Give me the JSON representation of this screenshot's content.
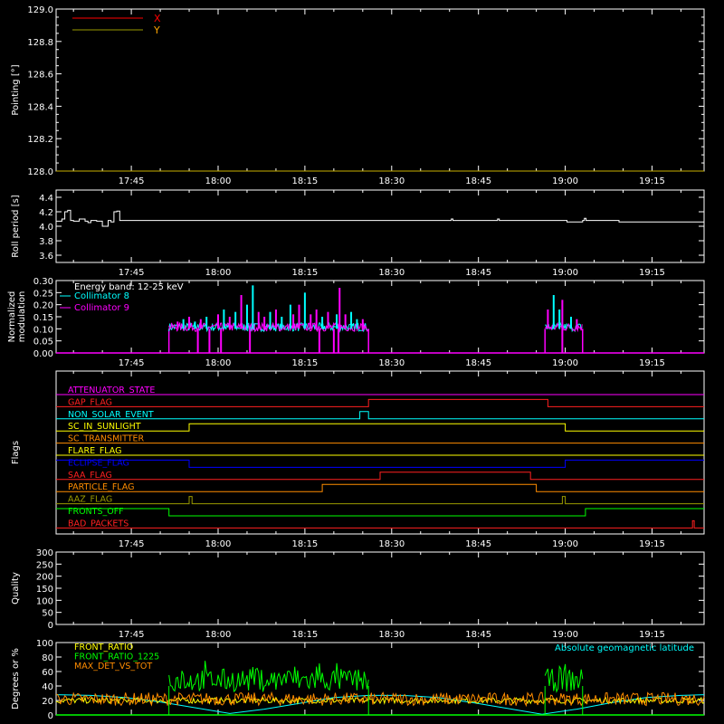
{
  "time_axis": {
    "ticks": [
      "17:45",
      "18:00",
      "18:15",
      "18:30",
      "18:45",
      "19:00",
      "19:15"
    ],
    "tick_minutes": [
      1065,
      1080,
      1095,
      1110,
      1125,
      1140,
      1155
    ],
    "range_minutes": [
      1052,
      1164
    ]
  },
  "chart_data": [
    {
      "type": "line",
      "ylabel": "Pointing [°]",
      "ylim": [
        128.0,
        129.0
      ],
      "yticks": [
        "128.0",
        "128.2",
        "128.4",
        "128.6",
        "128.8",
        "129.0"
      ],
      "ytick_values": [
        128.0,
        128.2,
        128.4,
        128.6,
        128.8,
        129.0
      ],
      "legend": [
        {
          "name": "X",
          "color": "#ff0000"
        },
        {
          "name": "Y",
          "color": "#ffa500"
        }
      ],
      "series": [
        {
          "name": "X",
          "color": "#ff0000",
          "x": [
            1052,
            1164
          ],
          "y": [
            128.0,
            128.0
          ]
        },
        {
          "name": "Y",
          "color": "#c9b000",
          "x": [
            1052,
            1164
          ],
          "y": [
            128.0,
            128.0
          ]
        }
      ]
    },
    {
      "type": "line",
      "ylabel": "Roll period [s]",
      "ylim": [
        3.5,
        4.5
      ],
      "yticks": [
        "3.6",
        "3.8",
        "4.0",
        "4.2",
        "4.4"
      ],
      "ytick_values": [
        3.6,
        3.8,
        4.0,
        4.2,
        4.4
      ],
      "series": [
        {
          "name": "roll",
          "color": "#ffffff",
          "x": [
            1052,
            1053,
            1053.5,
            1054,
            1054.5,
            1055,
            1056,
            1057,
            1057.5,
            1058,
            1059,
            1060,
            1061,
            1061.5,
            1062,
            1062.5,
            1063,
            1120,
            1120.3,
            1120.6,
            1128,
            1128.3,
            1128.6,
            1140,
            1140.3,
            1143,
            1143.3,
            1143.6,
            1149,
            1149.3,
            1164
          ],
          "y": [
            4.07,
            4.1,
            4.2,
            4.22,
            4.08,
            4.07,
            4.1,
            4.07,
            4.05,
            4.08,
            4.07,
            4.0,
            4.08,
            4.06,
            4.2,
            4.21,
            4.08,
            4.08,
            4.1,
            4.08,
            4.08,
            4.1,
            4.08,
            4.08,
            4.06,
            4.08,
            4.11,
            4.08,
            4.08,
            4.06,
            4.07
          ]
        }
      ]
    },
    {
      "type": "bar",
      "ylabel": "Normalized modulation",
      "ylim": [
        0.0,
        0.3
      ],
      "yticks": [
        "0.00",
        "0.05",
        "0.10",
        "0.15",
        "0.20",
        "0.25",
        "0.30"
      ],
      "ytick_values": [
        0.0,
        0.05,
        0.1,
        0.15,
        0.2,
        0.25,
        0.3
      ],
      "annotation": "Energy band: 12-25 keV",
      "legend": [
        {
          "name": "Collimator 8",
          "color": "#00ffff"
        },
        {
          "name": "Collimator 9",
          "color": "#ff00ff"
        }
      ],
      "active_intervals": [
        [
          1071.5,
          1106.0
        ],
        [
          1136.5,
          1143.0
        ]
      ],
      "baseline": 0.1,
      "series": [
        {
          "name": "Collimator 8",
          "color": "#00ffff",
          "spikes_x": [
            1074,
            1076,
            1078,
            1081,
            1083,
            1085,
            1086,
            1089,
            1091,
            1092.5,
            1095,
            1098,
            1100.5,
            1103,
            1104,
            1138,
            1139,
            1141
          ],
          "spikes_y": [
            0.14,
            0.13,
            0.15,
            0.18,
            0.17,
            0.2,
            0.28,
            0.17,
            0.15,
            0.2,
            0.25,
            0.15,
            0.16,
            0.17,
            0.14,
            0.24,
            0.18,
            0.15
          ]
        },
        {
          "name": "Collimator 9",
          "color": "#ff00ff",
          "spikes_x": [
            1073,
            1075,
            1077,
            1080,
            1082,
            1084,
            1087,
            1088,
            1090,
            1093,
            1094,
            1096,
            1097,
            1099,
            1101,
            1102,
            1105,
            1137,
            1139.5,
            1142
          ],
          "spikes_y": [
            0.13,
            0.15,
            0.14,
            0.16,
            0.15,
            0.24,
            0.17,
            0.15,
            0.18,
            0.16,
            0.2,
            0.16,
            0.18,
            0.17,
            0.27,
            0.16,
            0.14,
            0.18,
            0.22,
            0.14
          ]
        }
      ]
    },
    {
      "type": "line",
      "ylabel": "Flags",
      "flags": [
        {
          "name": "ATTENUATOR_STATE",
          "color": "#ff00ff",
          "x": [
            1052,
            1164
          ],
          "state": [
            0,
            0
          ]
        },
        {
          "name": "GAP_FLAG",
          "color": "#ff2020",
          "x": [
            1052,
            1106,
            1106,
            1137,
            1137,
            1164
          ],
          "state": [
            0,
            0,
            1,
            1,
            0,
            0
          ]
        },
        {
          "name": "NON_SOLAR_EVENT",
          "color": "#00ffff",
          "x": [
            1052,
            1104.5,
            1104.5,
            1106,
            1106,
            1164
          ],
          "state": [
            0,
            0,
            1,
            1,
            0,
            0
          ]
        },
        {
          "name": "SC_IN_SUNLIGHT",
          "color": "#ffff00",
          "x": [
            1052,
            1075,
            1075,
            1140,
            1140,
            1164
          ],
          "state": [
            0,
            0,
            1,
            1,
            0,
            0
          ]
        },
        {
          "name": "SC_TRANSMITTER",
          "color": "#ff8c00",
          "x": [
            1052,
            1164
          ],
          "state": [
            0,
            0
          ]
        },
        {
          "name": "FLARE_FLAG",
          "color": "#ffff00",
          "x": [
            1052,
            1164
          ],
          "state": [
            0,
            0
          ]
        },
        {
          "name": "ECLIPSE_FLAG",
          "color": "#0000ff",
          "x": [
            1052,
            1075,
            1075,
            1140,
            1140,
            1164
          ],
          "state": [
            1,
            1,
            0,
            0,
            1,
            1
          ]
        },
        {
          "name": "SAA_FLAG",
          "color": "#ff2020",
          "x": [
            1052,
            1108,
            1108,
            1134,
            1134,
            1164
          ],
          "state": [
            0,
            0,
            1,
            1,
            0,
            0
          ]
        },
        {
          "name": "PARTICLE_FLAG",
          "color": "#ff8c00",
          "x": [
            1052,
            1098,
            1098,
            1135,
            1135,
            1164
          ],
          "state": [
            0,
            0,
            1,
            1,
            0,
            0
          ]
        },
        {
          "name": "AAZ_FLAG",
          "color": "#9a9a00",
          "x": [
            1052,
            1075,
            1075,
            1075.5,
            1075.5,
            1139.5,
            1139.5,
            1140,
            1140,
            1164
          ],
          "state": [
            0,
            0,
            1,
            1,
            0,
            0,
            1,
            1,
            0,
            0
          ]
        },
        {
          "name": "FRONTS_OFF",
          "color": "#00ff00",
          "x": [
            1052,
            1071.5,
            1071.5,
            1143.5,
            1143.5,
            1164
          ],
          "state": [
            1,
            1,
            0,
            0,
            1,
            1
          ]
        },
        {
          "name": "BAD_PACKETS",
          "color": "#ff2020",
          "x": [
            1052,
            1162,
            1162,
            1162.3,
            1162.3,
            1164
          ],
          "state": [
            0,
            0,
            1,
            1,
            0,
            0
          ]
        }
      ]
    },
    {
      "type": "line",
      "ylabel": "Quality",
      "ylim": [
        0,
        300
      ],
      "yticks": [
        "0",
        "50",
        "100",
        "150",
        "200",
        "250",
        "300"
      ],
      "ytick_values": [
        0,
        50,
        100,
        150,
        200,
        250,
        300
      ],
      "series": []
    },
    {
      "type": "line",
      "ylabel": "Degrees or %",
      "ylim": [
        0,
        100
      ],
      "yticks": [
        "0",
        "20",
        "40",
        "60",
        "80",
        "100"
      ],
      "ytick_values": [
        0,
        20,
        40,
        60,
        80,
        100
      ],
      "legend": [
        {
          "name": "FRONT_RATIO",
          "color": "#ffff00"
        },
        {
          "name": "FRONT_RATIO_1225",
          "color": "#00ff00"
        },
        {
          "name": "MAX_DET_VS_TOT",
          "color": "#ff8c00"
        }
      ],
      "right_label": {
        "text": "Absolute geomagnetic latitude",
        "color": "#00ffff"
      },
      "series": [
        {
          "name": "Absolute geomagnetic latitude",
          "color": "#00ffff",
          "x": [
            1052,
            1058,
            1064,
            1070,
            1076,
            1082,
            1088,
            1094,
            1100,
            1106,
            1112,
            1118,
            1124,
            1130,
            1136,
            1142,
            1148,
            1154,
            1160,
            1164
          ],
          "y": [
            28,
            27,
            24,
            18,
            10,
            2,
            8,
            16,
            24,
            27,
            27,
            24,
            17,
            9,
            1,
            8,
            17,
            24,
            27,
            28
          ]
        },
        {
          "name": "FRONT_RATIO_1225",
          "color": "#00ff00",
          "mean": 48,
          "spread": 16,
          "intervals": [
            [
              1071.5,
              1106.0
            ],
            [
              1136.5,
              1143.0
            ]
          ]
        },
        {
          "name": "MAX_DET_VS_TOT",
          "color": "#ff8c00",
          "mean": 22,
          "spread": 9,
          "intervals": [
            [
              1052,
              1164
            ]
          ]
        },
        {
          "name": "FRONT_RATIO",
          "color": "#ffff00",
          "mean": 20,
          "spread": 4,
          "intervals": [
            [
              1052,
              1164
            ]
          ]
        }
      ]
    }
  ]
}
